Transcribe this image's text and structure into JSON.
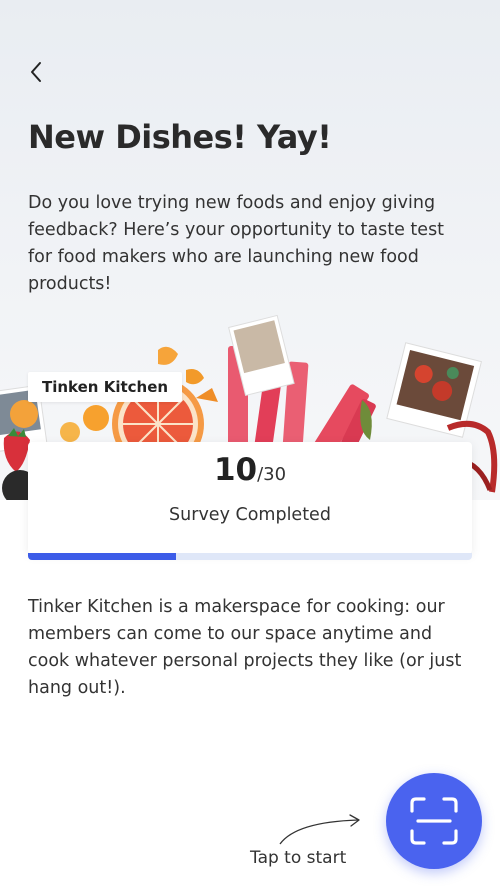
{
  "header": {
    "back_icon": "chevron-left-icon",
    "title": "New Dishes! Yay!",
    "intro": "Do you love trying new foods and enjoy giving feedback? Here’s your opportunity to taste test for food makers who are launching new food products!"
  },
  "tag": {
    "label": "Tinken Kitchen"
  },
  "survey": {
    "completed": "10",
    "total": "/30",
    "label": "Survey Completed",
    "progress_fraction": 0.333
  },
  "about": {
    "text": "Tinker Kitchen is a makerspace for cooking: our members can come to our space anytime and cook whatever personal projects they like (or just hang out!)."
  },
  "cta": {
    "label": "Tap to start",
    "icon": "scan-icon",
    "accent": "#4a63ef"
  },
  "colors": {
    "progress_fill": "#3c5ce8",
    "progress_track": "#dfe7f8"
  }
}
